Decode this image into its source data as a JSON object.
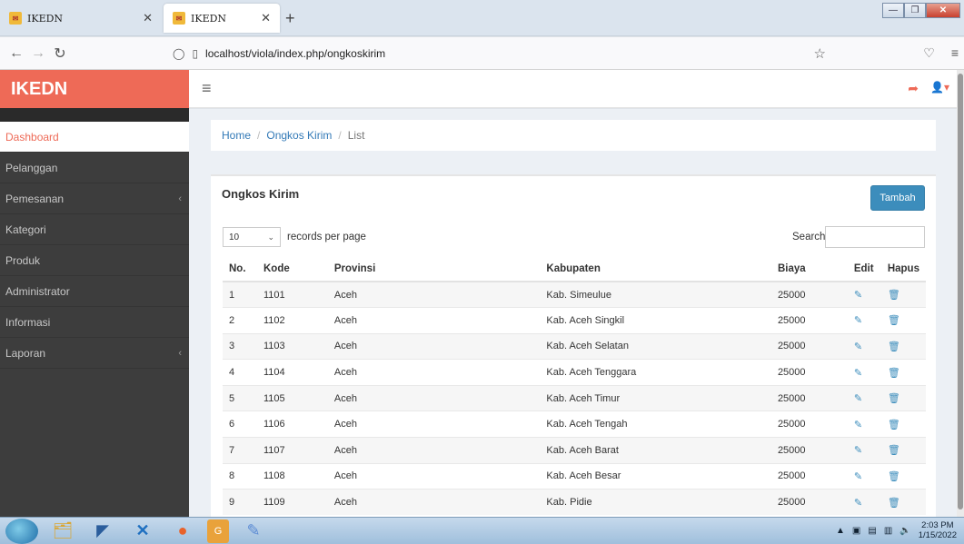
{
  "browser": {
    "tabs": [
      {
        "title": "IKEDN",
        "active": false
      },
      {
        "title": "IKEDN",
        "active": true
      }
    ],
    "url": "localhost/viola/index.php/ongkoskirim"
  },
  "app": {
    "brand": "IKEDN",
    "accent": "#ee6a57",
    "sidebar": {
      "items": [
        {
          "label": "Dashboard",
          "active": true,
          "has_submenu": false
        },
        {
          "label": "Pelanggan",
          "active": false,
          "has_submenu": false
        },
        {
          "label": "Pemesanan",
          "active": false,
          "has_submenu": true
        },
        {
          "label": "Kategori",
          "active": false,
          "has_submenu": false
        },
        {
          "label": "Produk",
          "active": false,
          "has_submenu": false
        },
        {
          "label": "Administrator",
          "active": false,
          "has_submenu": false
        },
        {
          "label": "Informasi",
          "active": false,
          "has_submenu": false
        },
        {
          "label": "Laporan",
          "active": false,
          "has_submenu": true
        }
      ]
    },
    "breadcrumb": {
      "home": "Home",
      "section": "Ongkos Kirim",
      "current": "List",
      "sep": "/"
    },
    "panel": {
      "title": "Ongkos Kirim",
      "add_button": "Tambah",
      "page_length": "10",
      "page_length_label": "records per page",
      "search_label": "Search:",
      "search_value": ""
    },
    "table": {
      "headers": [
        "No.",
        "Kode",
        "Provinsi",
        "Kabupaten",
        "Biaya",
        "Edit",
        "Hapus"
      ],
      "rows": [
        [
          "1",
          "1101",
          "Aceh",
          "Kab. Simeulue",
          "25000"
        ],
        [
          "2",
          "1102",
          "Aceh",
          "Kab. Aceh Singkil",
          "25000"
        ],
        [
          "3",
          "1103",
          "Aceh",
          "Kab. Aceh Selatan",
          "25000"
        ],
        [
          "4",
          "1104",
          "Aceh",
          "Kab. Aceh Tenggara",
          "25000"
        ],
        [
          "5",
          "1105",
          "Aceh",
          "Kab. Aceh Timur",
          "25000"
        ],
        [
          "6",
          "1106",
          "Aceh",
          "Kab. Aceh Tengah",
          "25000"
        ],
        [
          "7",
          "1107",
          "Aceh",
          "Kab. Aceh Barat",
          "25000"
        ],
        [
          "8",
          "1108",
          "Aceh",
          "Kab. Aceh Besar",
          "25000"
        ],
        [
          "9",
          "1109",
          "Aceh",
          "Kab. Pidie",
          "25000"
        ]
      ]
    }
  },
  "taskbar": {
    "time": "2:03 PM",
    "date": "1/15/2022",
    "apps": [
      "start-orb",
      "file-explorer-icon",
      "dolphin-icon",
      "vscode-icon",
      "firefox-icon",
      "pdf-icon",
      "paint-icon"
    ]
  }
}
